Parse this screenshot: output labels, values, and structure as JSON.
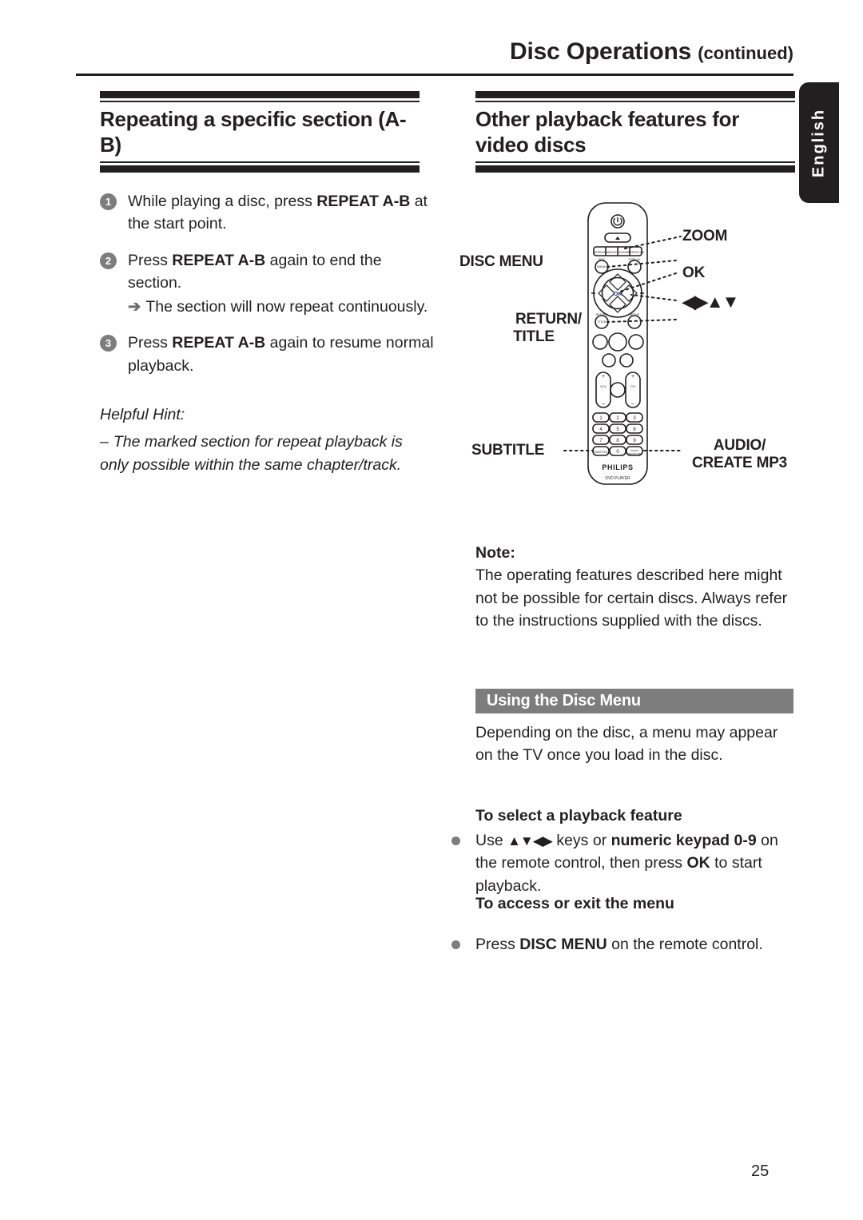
{
  "header": {
    "title": "Disc Operations",
    "continued": "(continued)",
    "language_tab": "English"
  },
  "left_column": {
    "heading": "Repeating a specific section (A-B)",
    "steps": [
      {
        "number": "1",
        "text_before": "While playing a disc, press ",
        "bold": "REPEAT A-B",
        "text_after": " at the start point."
      },
      {
        "number": "2",
        "text_before": "Press ",
        "bold": "REPEAT A-B",
        "text_after": " again to end the section.",
        "result_arrow": "➔",
        "result": "The section will now repeat continuously."
      },
      {
        "number": "3",
        "text_before": "Press ",
        "bold": "REPEAT A-B",
        "text_after": " again to resume normal playback."
      }
    ],
    "hint_title": "Helpful Hint:",
    "hint_dash": "–",
    "hint_text": "The marked section for repeat playback is only possible within the same chapter/track."
  },
  "right_column": {
    "heading": "Other playback features for video discs",
    "remote": {
      "labels": {
        "zoom": "ZOOM",
        "ok": "OK",
        "arrows": "◀▶▲▼",
        "disc_menu": "DISC MENU",
        "return_title_line1": "RETURN/",
        "return_title_line2": "TITLE",
        "subtitle": "SUBTITLE",
        "audio_line1": "AUDIO/",
        "audio_line2": "CREATE MP3"
      },
      "buttons": {
        "top_row": [
          "REPEAT",
          "ANGLE",
          "ZOOM",
          "REPEAT A-B"
        ],
        "disc_menu_small": "DISC MENU",
        "display_small": "DISPLAY",
        "return_small": "RETURN TITLE",
        "setup_small": "SETUP",
        "ok_small": "OK",
        "volume_small": "VOL",
        "channel_small": "CH",
        "numeric_keys": [
          "1",
          "2",
          "3",
          "4",
          "5",
          "6",
          "7",
          "8",
          "9",
          "0"
        ],
        "subtitle_small": "SUBTITLE",
        "audio_small": "AUDIO/ CREATE MP3",
        "brand": "PHILIPS",
        "model": "DVD PLAYER"
      }
    },
    "note_title": "Note:",
    "note_text": "The operating features described here might not be possible for certain discs. Always refer to the instructions supplied with the discs.",
    "section_bar": "Using the Disc Menu",
    "paragraph": "Depending on the disc, a menu may appear on the TV once you load in the disc.",
    "select_heading": "To select a playback feature",
    "select_bullet": {
      "part1": "Use ",
      "arrows": "▲▼◀▶",
      "part2": " keys or ",
      "bold1": "numeric keypad 0-9",
      "part3": " on the remote control, then press ",
      "bold2": "OK",
      "part4": " to start playback."
    },
    "access_heading": "To access or exit the menu",
    "access_bullet": {
      "part1": "Press ",
      "bold1": "DISC MENU",
      "part2": " on the remote control."
    }
  },
  "footer": {
    "page_number": "25"
  },
  "colors": {
    "ink": "#231f20",
    "gray": "#7d7d7d",
    "white": "#ffffff"
  }
}
